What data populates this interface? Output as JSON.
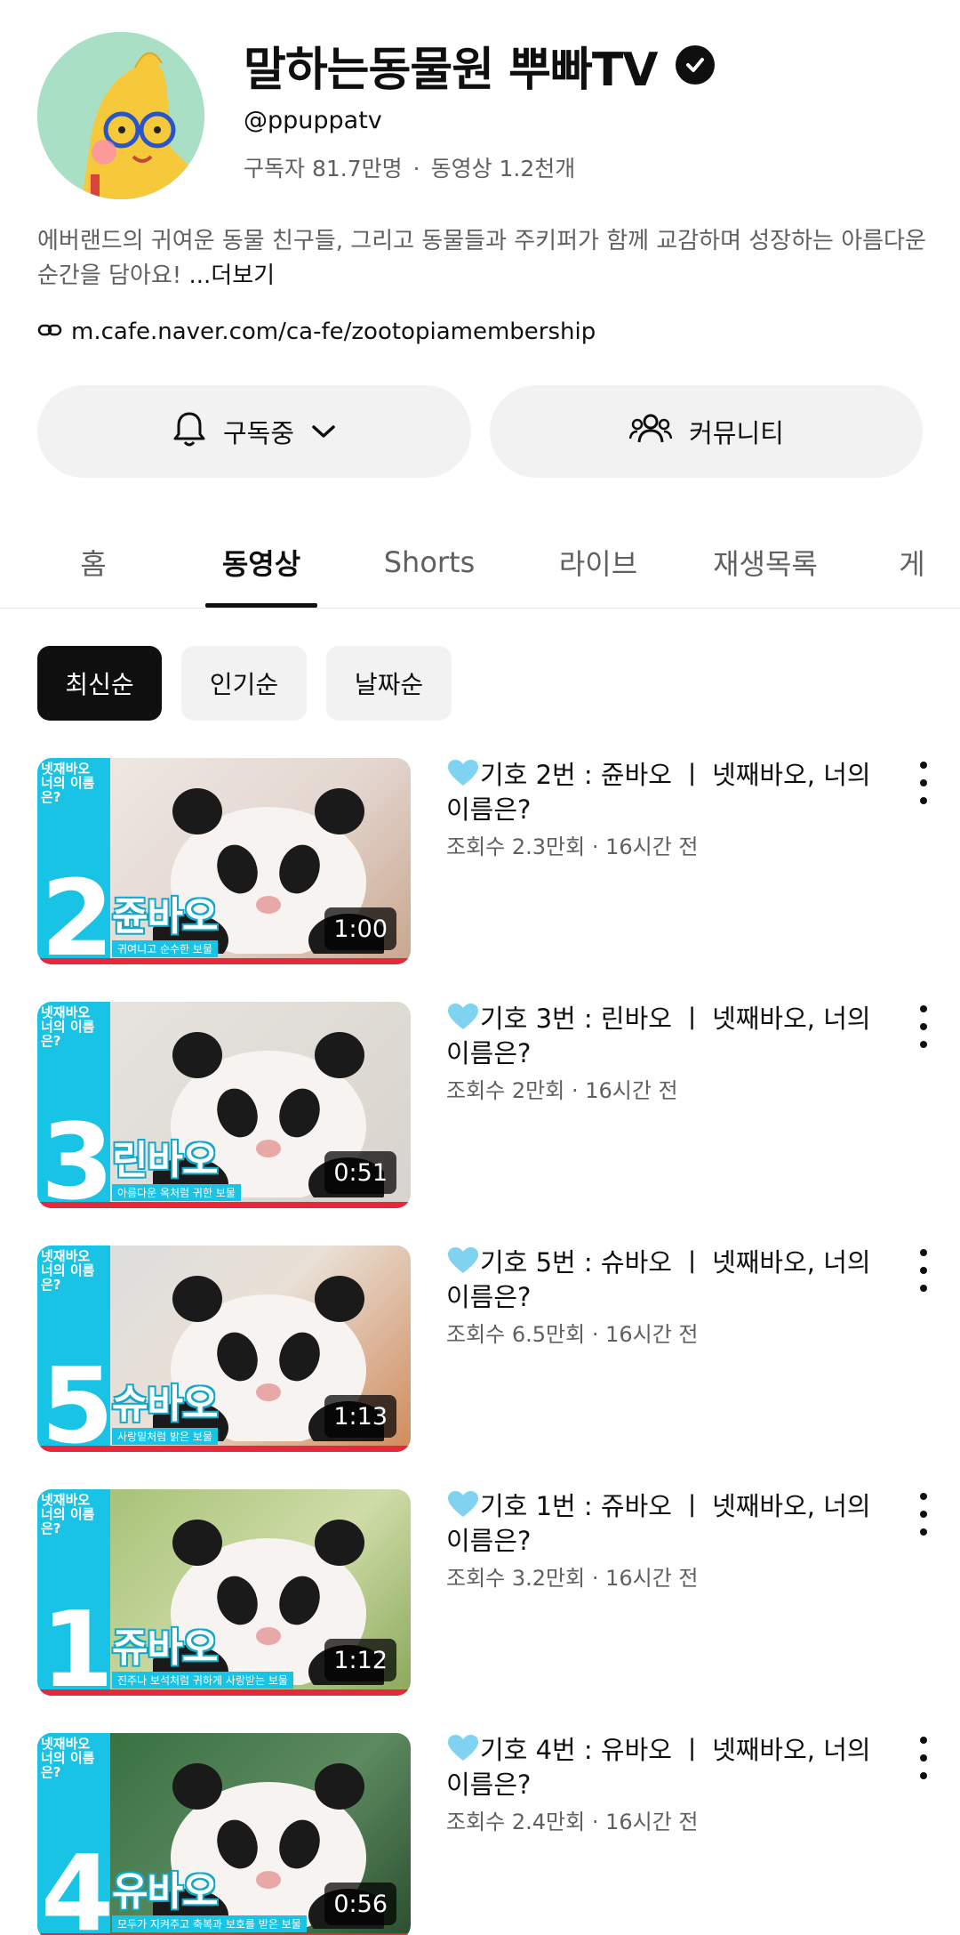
{
  "channel": {
    "name": "말하는동물원 뿌빠TV",
    "handle": "@ppuppatv",
    "subscribers": "구독자 81.7만명",
    "videos_count": "동영상 1.2천개",
    "description": "에버랜드의 귀여운 동물 친구들, 그리고 동물들과 주키퍼가 함께 교감하며 성장하는 아름다운 순간을 담아요!",
    "more_label": "...더보기",
    "link": "m.cafe.naver.com/ca-fe/zootopiamembership"
  },
  "buttons": {
    "subscribed": "구독중",
    "community": "커뮤니티"
  },
  "tabs": [
    {
      "label": "홈",
      "active": false
    },
    {
      "label": "동영상",
      "active": true
    },
    {
      "label": "Shorts",
      "active": false
    },
    {
      "label": "라이브",
      "active": false
    },
    {
      "label": "재생목록",
      "active": false
    },
    {
      "label": "게",
      "active": false
    }
  ],
  "chips": [
    {
      "label": "최신순",
      "active": true
    },
    {
      "label": "인기순",
      "active": false
    },
    {
      "label": "날짜순",
      "active": false
    }
  ],
  "videos": [
    {
      "title": "기호 2번 : 쥰바오 ㅣ 넷째바오, 너의 이름은?",
      "views": "조회수 2.3만회",
      "age": "16시간 전",
      "duration": "1:00",
      "thumb_number": "2",
      "thumb_name": "쥰바오",
      "thumb_tag": "귀여니고 순수한 보물",
      "thumb_top": "넷재바오 너의 이름은?"
    },
    {
      "title": "기호 3번 : 린바오 ㅣ 넷째바오, 너의 이름은?",
      "views": "조회수 2만회",
      "age": "16시간 전",
      "duration": "0:51",
      "thumb_number": "3",
      "thumb_name": "린바오",
      "thumb_tag": "아름다운 옥처럼 귀한 보물",
      "thumb_top": "넷재바오 너의 이름은?"
    },
    {
      "title": "기호 5번 : 슈바오 ㅣ 넷째바오, 너의 이름은?",
      "views": "조회수 6.5만회",
      "age": "16시간 전",
      "duration": "1:13",
      "thumb_number": "5",
      "thumb_name": "슈바오",
      "thumb_tag": "사랑밑처럼 밝은 보물",
      "thumb_top": "넷재바오 너의 이름은?"
    },
    {
      "title": "기호 1번 : 쥬바오 ㅣ 넷째바오, 너의 이름은?",
      "views": "조회수 3.2만회",
      "age": "16시간 전",
      "duration": "1:12",
      "thumb_number": "1",
      "thumb_name": "쥬바오",
      "thumb_tag": "진주나 보석처럼 귀하게 사랑받는 보물",
      "thumb_top": "넷재바오 너의 이름은?"
    },
    {
      "title": "기호 4번 : 유바오 ㅣ 넷째바오, 너의 이름은?",
      "views": "조회수 2.4만회",
      "age": "16시간 전",
      "duration": "0:56",
      "thumb_number": "4",
      "thumb_name": "유바오",
      "thumb_tag": "모두가 지켜주고 축복과 보호를 받은 보물",
      "thumb_top": "넷재바오 너의 이름은?"
    }
  ],
  "colors": {
    "accent_cyan": "#19c3e6",
    "progress_red": "#e6283a",
    "heart": "#7fd3f0"
  },
  "icons": [
    "checkmark-verified-icon",
    "link-icon",
    "bell-icon",
    "chevron-down-icon",
    "people-icon",
    "heart-icon",
    "more-vertical-icon"
  ]
}
